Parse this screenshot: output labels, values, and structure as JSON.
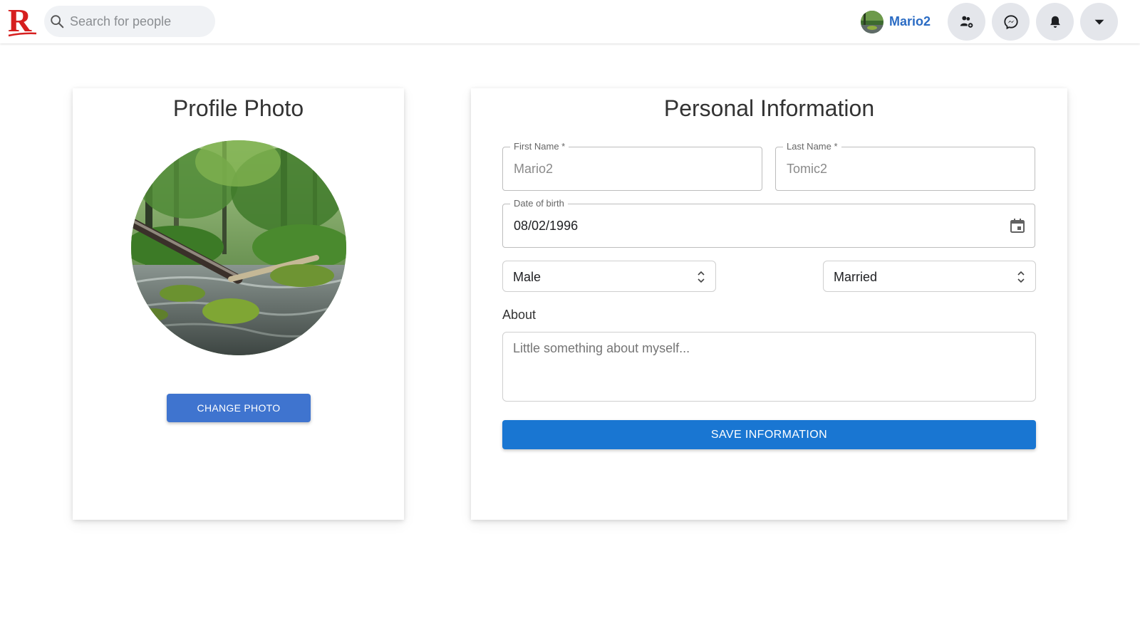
{
  "header": {
    "logo_icon": "r-logo-icon",
    "search_placeholder": "Search for people",
    "user_name": "Mario2",
    "buttons": [
      "friend-requests-icon",
      "messenger-icon",
      "bell-icon",
      "caret-down-icon"
    ]
  },
  "photo_card": {
    "title": "Profile Photo",
    "change_label": "CHANGE PHOTO"
  },
  "info_card": {
    "title": "Personal Information",
    "first_name": {
      "label": "First Name *",
      "value": "Mario2"
    },
    "last_name": {
      "label": "Last Name *",
      "value": "Tomic2"
    },
    "dob": {
      "label": "Date of birth",
      "value": "08/02/1996"
    },
    "gender": "Male",
    "status": "Married",
    "about_label": "About",
    "about_placeholder": "Little something about myself...",
    "save_label": "SAVE INFORMATION"
  },
  "colors": {
    "accent_blue": "#1976d2",
    "change_button": "#3f74cf",
    "username": "#2b6cc4",
    "logo_red": "#d61f1f"
  }
}
